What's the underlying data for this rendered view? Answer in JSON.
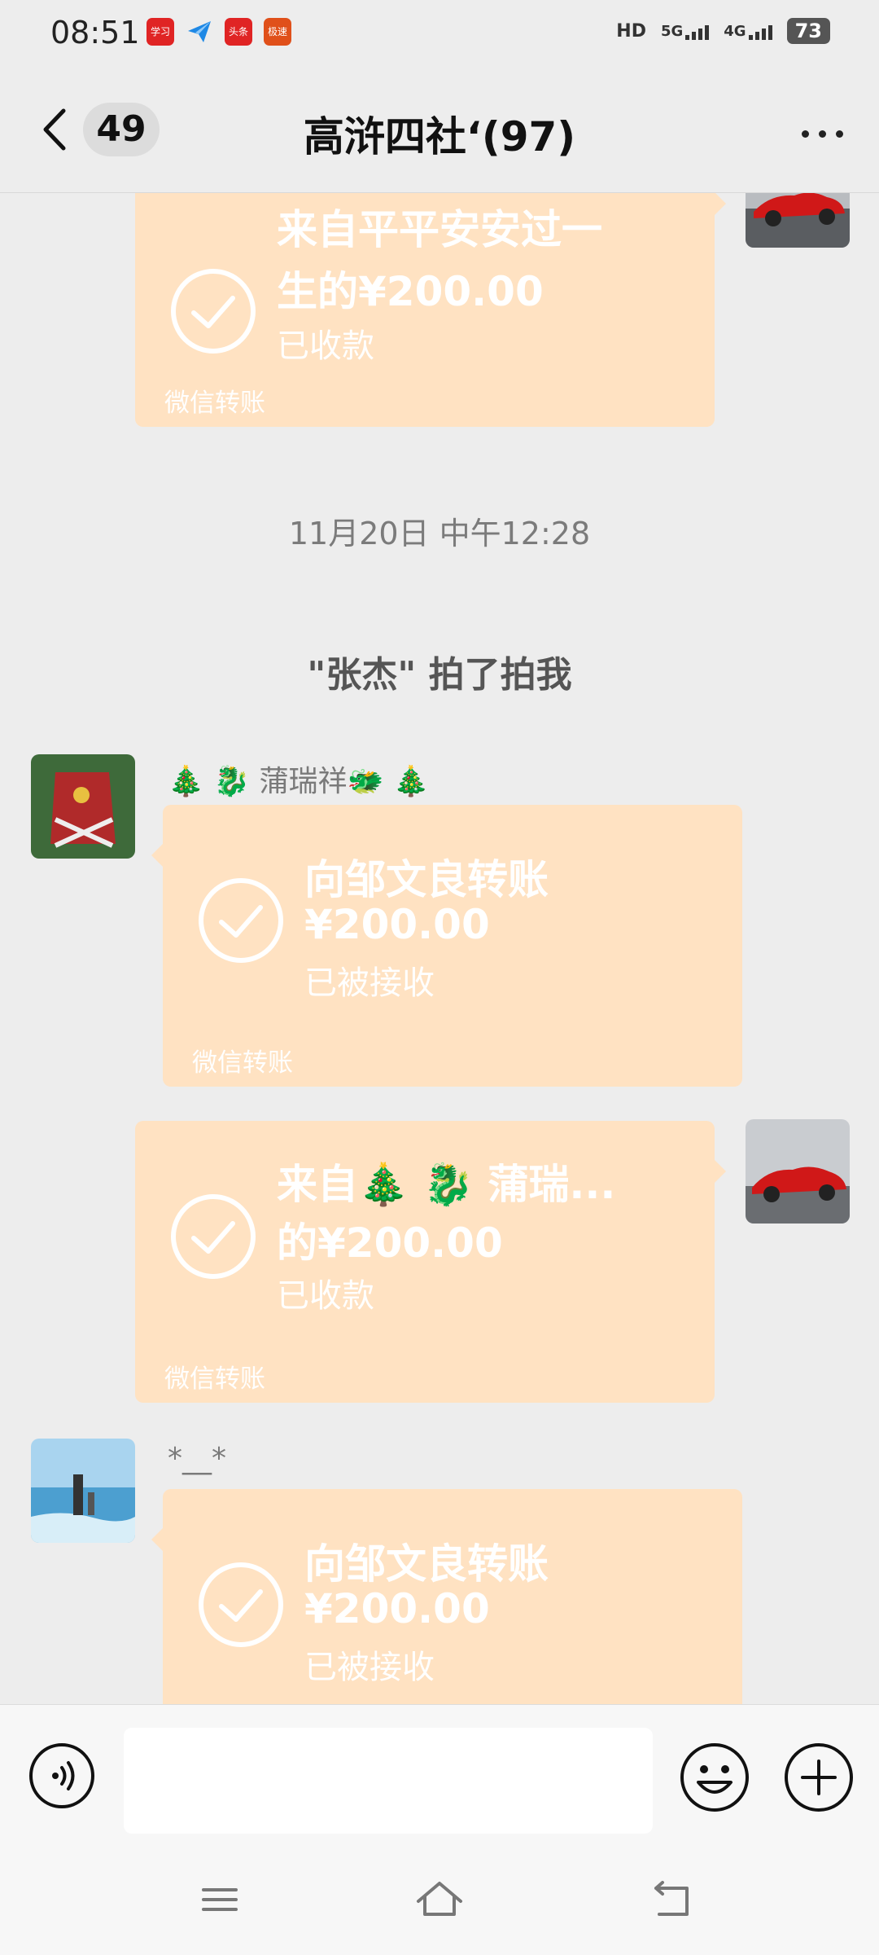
{
  "status_bar": {
    "time": "08:51",
    "notif_icons": [
      {
        "name": "app-icon-red",
        "color": "#e02424",
        "glyph": "学习"
      },
      {
        "name": "paper-plane-icon",
        "color": "#ffffff",
        "glyph": ""
      },
      {
        "name": "app-icon-toutiao",
        "color": "#e02424",
        "glyph": "头条"
      },
      {
        "name": "app-icon-orange",
        "color": "#e0501a",
        "glyph": "极速"
      }
    ],
    "hd_label": "HD",
    "net_5g": "5G",
    "net_4g": "4G",
    "battery": "73"
  },
  "header": {
    "back_icon": "chevron-left-icon",
    "unread_count": "49",
    "title": "高浒四社‘(97)",
    "more_icon": "more-dots-icon"
  },
  "messages": {
    "card1": {
      "line1": "来自平平安安过一",
      "line2": "生的¥200.00",
      "status": "已收款",
      "footer": "微信转账"
    },
    "timestamp": "11月20日 中午12:28",
    "pat_notice": "\"张杰\" 拍了拍我",
    "sender1": "🎄 🐉 蒲瑞祥🐲 🎄",
    "card2": {
      "line1": "向邹文良转账",
      "line2": "¥200.00",
      "status": "已被接收",
      "footer": "微信转账"
    },
    "card3": {
      "line1": "来自🎄 🐉 蒲瑞...",
      "line2": "的¥200.00",
      "status": "已收款",
      "footer": "微信转账"
    },
    "sender2": "*__*",
    "card4": {
      "line1": "向邹文良转账",
      "line2": "¥200.00",
      "status": "已被接收"
    }
  },
  "input_bar": {
    "voice_icon": "voice-icon",
    "input_value": "",
    "emoji_icon": "emoji-icon",
    "plus_icon": "plus-icon"
  },
  "nav": {
    "menu_icon": "menu-icon",
    "home_icon": "home-icon",
    "back_icon": "back-icon"
  },
  "colors": {
    "background": "#ededed",
    "transfer_card": "#ffe2c2",
    "card_text": "#ffffff"
  }
}
